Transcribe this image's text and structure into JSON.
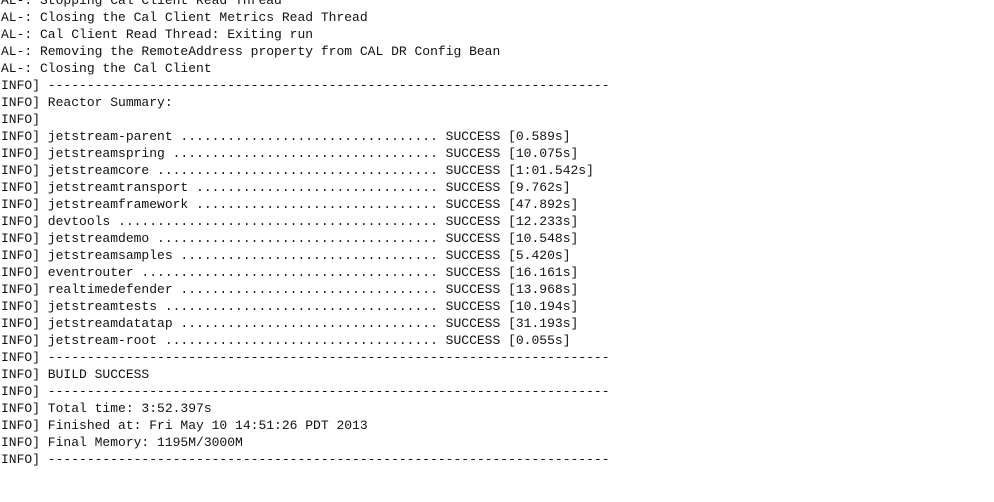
{
  "console": {
    "lines": [
      "AL-: Stopping Cal Client Read Thread",
      "AL-: Closing the Cal Client Metrics Read Thread",
      "AL-: Cal Client Read Thread: Exiting run",
      "AL-: Removing the RemoteAddress property from CAL DR Config Bean",
      "AL-: Closing the Cal Client",
      "INFO] ------------------------------------------------------------------------",
      "INFO] Reactor Summary:",
      "INFO]",
      "INFO] jetstream-parent ................................. SUCCESS [0.589s]",
      "INFO] jetstreamspring .................................. SUCCESS [10.075s]",
      "INFO] jetstreamcore .................................... SUCCESS [1:01.542s]",
      "INFO] jetstreamtransport ............................... SUCCESS [9.762s]",
      "INFO] jetstreamframework ............................... SUCCESS [47.892s]",
      "INFO] devtools ......................................... SUCCESS [12.233s]",
      "INFO] jetstreamdemo .................................... SUCCESS [10.548s]",
      "INFO] jetstreamsamples ................................. SUCCESS [5.420s]",
      "INFO] eventrouter ...................................... SUCCESS [16.161s]",
      "INFO] realtimedefender ................................. SUCCESS [13.968s]",
      "INFO] jetstreamtests ................................... SUCCESS [10.194s]",
      "INFO] jetstreamdatatap ................................. SUCCESS [31.193s]",
      "INFO] jetstream-root ................................... SUCCESS [0.055s]",
      "INFO] ------------------------------------------------------------------------",
      "INFO] BUILD SUCCESS",
      "INFO] ------------------------------------------------------------------------",
      "INFO] Total time: 3:52.397s",
      "INFO] Finished at: Fri May 10 14:51:26 PDT 2013",
      "INFO] Final Memory: 1195M/3000M",
      "INFO] ------------------------------------------------------------------------"
    ]
  }
}
